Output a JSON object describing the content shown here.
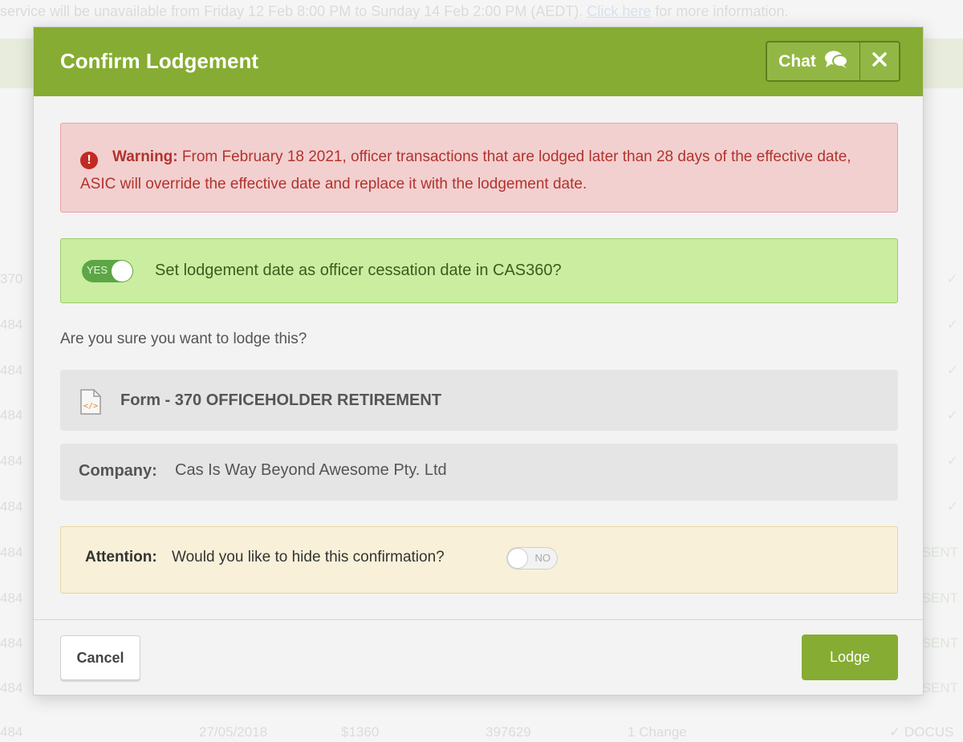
{
  "background": {
    "banner": {
      "text_before": "service will be unavailable from Friday 12 Feb 8:00 PM to Sunday 14 Feb 2:00 PM (AEDT).",
      "link": "Click here",
      "text_after": "for more information."
    },
    "rows": [
      {
        "id": "370",
        "end": "✓"
      },
      {
        "id": "484",
        "end": "✓"
      },
      {
        "id": "484",
        "end": "✓"
      },
      {
        "id": "484",
        "end": "✓"
      },
      {
        "id": "484",
        "end": "✓"
      },
      {
        "id": "484",
        "end": "✓"
      },
      {
        "id": "484",
        "end": "SENT"
      },
      {
        "id": "484",
        "end": "SENT"
      },
      {
        "id": "484",
        "end": "SENT"
      },
      {
        "id": "484",
        "end": "SENT"
      }
    ],
    "footer_row": {
      "id": "484",
      "date": "27/05/2018",
      "amount": "$1360",
      "number": "397629",
      "changes": "1 Change",
      "status": "✓ DOCUS"
    }
  },
  "modal": {
    "title": "Confirm Lodgement",
    "chat_label": "Chat",
    "icons": {
      "chat": "chat-bubbles-icon",
      "close": "close-icon",
      "warning": "exclamation-circle-icon",
      "file": "code-file-icon"
    },
    "warning": {
      "label": "Warning:",
      "text": "From February 18 2021, officer transactions that are lodged later than 28 days of the effective date, ASIC will override the effective date and replace it with the lodgement date."
    },
    "lodgement_toggle": {
      "state_label": "YES",
      "on": true,
      "label": "Set lodgement date as officer cessation date in CAS360?"
    },
    "question": "Are you sure you want to lodge this?",
    "form": {
      "label": "Form - 370 OFFICEHOLDER RETIREMENT"
    },
    "company": {
      "key": "Company:",
      "value": "Cas Is Way Beyond Awesome Pty. Ltd"
    },
    "attention": {
      "key": "Attention:",
      "text": "Would you like to hide this confirmation?",
      "toggle_label": "NO",
      "on": false
    },
    "buttons": {
      "cancel": "Cancel",
      "lodge": "Lodge"
    }
  },
  "colors": {
    "header_green": "#86ac33",
    "warning_bg": "#f2d0d0",
    "warning_text": "#b2332c",
    "success_bg": "#cbeda0",
    "toggle_on": "#5ca645",
    "attention_bg": "#f8f0d8"
  }
}
